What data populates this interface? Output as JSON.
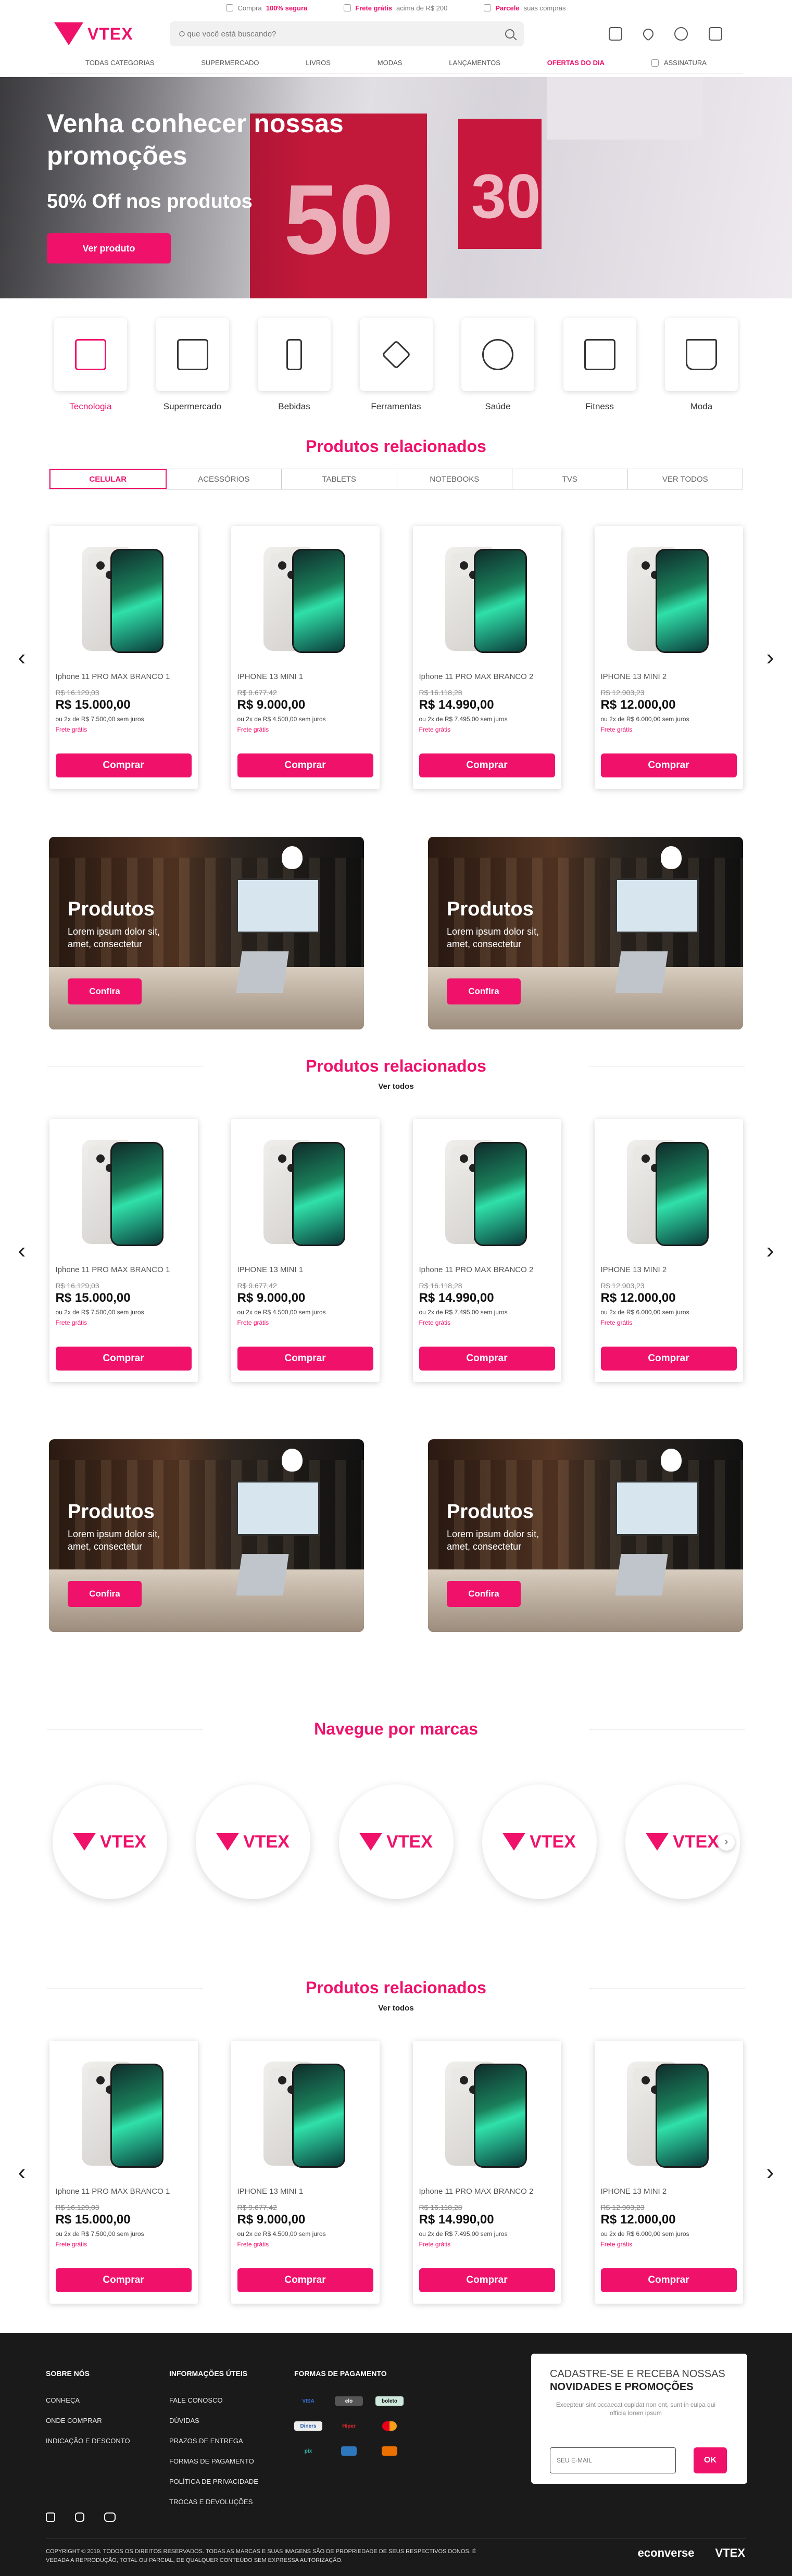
{
  "topbar": {
    "items": [
      {
        "pre": "Compra ",
        "bold": "100% segura",
        "post": ""
      },
      {
        "pre": "",
        "bold": "Frete grátis",
        "post": " acima de R$ 200"
      },
      {
        "pre": "",
        "bold": "Parcele",
        "post": " suas compras"
      }
    ]
  },
  "header": {
    "logo_text": "VTEX",
    "search_placeholder": "O que você está buscando?"
  },
  "nav": {
    "items": [
      "TODAS CATEGORIAS",
      "SUPERMERCADO",
      "LIVROS",
      "MODAS",
      "LANÇAMENTOS",
      "OFERTAS DO DIA",
      "ASSINATURA"
    ]
  },
  "hero": {
    "title": "Venha conhecer nossas promoções",
    "subtitle": "50% Off nos produtos",
    "cta": "Ver produto"
  },
  "categories": [
    {
      "label": "Tecnologia",
      "icon": "monitor-icon"
    },
    {
      "label": "Supermercado",
      "icon": "store-icon"
    },
    {
      "label": "Bebidas",
      "icon": "bottle-icon"
    },
    {
      "label": "Ferramentas",
      "icon": "tools-icon"
    },
    {
      "label": "Saúde",
      "icon": "health-icon"
    },
    {
      "label": "Fitness",
      "icon": "treadmill-icon"
    },
    {
      "label": "Moda",
      "icon": "fashion-icon"
    }
  ],
  "shelf1": {
    "title": "Produtos relacionados",
    "tabs": [
      "CELULAR",
      "ACESSÓRIOS",
      "TABLETS",
      "NOTEBOOKS",
      "TVS",
      "VER TODOS"
    ],
    "products": [
      {
        "name": "Iphone 11 PRO MAX BRANCO 1",
        "old": "R$ 16.129,03",
        "price": "R$ 15.000,00",
        "inst": "ou 2x de R$ 7.500,00 sem juros",
        "ship": "Frete grátis",
        "cta": "Comprar"
      },
      {
        "name": "IPHONE 13 MINI 1",
        "old": "R$ 9.677,42",
        "price": "R$ 9.000,00",
        "inst": "ou 2x de R$ 4.500,00 sem juros",
        "ship": "Frete grátis",
        "cta": "Comprar"
      },
      {
        "name": "Iphone 11 PRO MAX BRANCO 2",
        "old": "R$ 16.118,28",
        "price": "R$ 14.990,00",
        "inst": "ou 2x de R$ 7.495,00 sem juros",
        "ship": "Frete grátis",
        "cta": "Comprar"
      },
      {
        "name": "IPHONE 13 MINI 2",
        "old": "R$ 12.903,23",
        "price": "R$ 12.000,00",
        "inst": "ou 2x de R$ 6.000,00 sem juros",
        "ship": "Frete grátis",
        "cta": "Comprar"
      }
    ]
  },
  "banners": {
    "title": "Produtos",
    "text": "Lorem ipsum dolor sit, amet, consectetur",
    "cta": "Confira"
  },
  "shelf2": {
    "title": "Produtos relacionados",
    "see_all": "Ver todos",
    "products": [
      {
        "name": "Iphone 11 PRO MAX BRANCO 1",
        "old": "R$ 16.129,03",
        "price": "R$ 15.000,00",
        "inst": "ou 2x de R$ 7.500,00 sem juros",
        "ship": "Frete grátis",
        "cta": "Comprar"
      },
      {
        "name": "IPHONE 13 MINI 1",
        "old": "R$ 9.677,42",
        "price": "R$ 9.000,00",
        "inst": "ou 2x de R$ 4.500,00 sem juros",
        "ship": "Frete grátis",
        "cta": "Comprar"
      },
      {
        "name": "Iphone 11 PRO MAX BRANCO 2",
        "old": "R$ 16.118,28",
        "price": "R$ 14.990,00",
        "inst": "ou 2x de R$ 7.495,00 sem juros",
        "ship": "Frete grátis",
        "cta": "Comprar"
      },
      {
        "name": "IPHONE 13 MINI 2",
        "old": "R$ 12.903,23",
        "price": "R$ 12.000,00",
        "inst": "ou 2x de R$ 6.000,00 sem juros",
        "ship": "Frete grátis",
        "cta": "Comprar"
      }
    ]
  },
  "brands": {
    "title": "Navegue por marcas",
    "items": [
      "VTEX",
      "VTEX",
      "VTEX",
      "VTEX",
      "VTEX"
    ]
  },
  "shelf3": {
    "title": "Produtos relacionados",
    "see_all": "Ver todos",
    "products": [
      {
        "name": "Iphone 11 PRO MAX BRANCO 1",
        "old": "R$ 16.129,03",
        "price": "R$ 15.000,00",
        "inst": "ou 2x de R$ 7.500,00 sem juros",
        "ship": "Frete grátis",
        "cta": "Comprar"
      },
      {
        "name": "IPHONE 13 MINI 1",
        "old": "R$ 9.677,42",
        "price": "R$ 9.000,00",
        "inst": "ou 2x de R$ 4.500,00 sem juros",
        "ship": "Frete grátis",
        "cta": "Comprar"
      },
      {
        "name": "Iphone 11 PRO MAX BRANCO 2",
        "old": "R$ 16.118,28",
        "price": "R$ 14.990,00",
        "inst": "ou 2x de R$ 7.495,00 sem juros",
        "ship": "Frete grátis",
        "cta": "Comprar"
      },
      {
        "name": "IPHONE 13 MINI 2",
        "old": "R$ 12.903,23",
        "price": "R$ 12.000,00",
        "inst": "ou 2x de R$ 6.000,00 sem juros",
        "ship": "Frete grátis",
        "cta": "Comprar"
      }
    ]
  },
  "footer": {
    "about": {
      "title": "SOBRE NÓS",
      "links": [
        "CONHEÇA",
        "ONDE COMPRAR",
        "INDICAÇÃO E DESCONTO"
      ]
    },
    "info": {
      "title": "INFORMAÇÕES ÚTEIS",
      "links": [
        "FALE CONOSCO",
        "DÚVIDAS",
        "PRAZOS DE ENTREGA",
        "FORMAS DE PAGAMENTO",
        "POLÍTICA DE PRIVACIDADE",
        "TROCAS E DEVOLUÇÕES"
      ]
    },
    "payments": {
      "title": "FORMAS DE PAGAMENTO",
      "items": [
        "VISA",
        "elo",
        "boleto",
        "Diners",
        "Hiper",
        "Mastercard",
        "pix",
        "Amex",
        "Itaú",
        "Paypal"
      ]
    },
    "newsletter": {
      "line1": "CADASTRE-SE E RECEBA NOSSAS",
      "line2": "NOVIDADES E PROMOÇÕES",
      "text": "Excepteur sint occaecat cupidat non ent, sunt in culpa qui officia lorem ipsum",
      "placeholder": "SEU E-MAIL",
      "cta": "OK"
    },
    "copyright": "COPYRIGHT © 2019. TODOS OS DIREITOS RESERVADOS. TODAS AS MARCAS E SUAS IMAGENS SÃO DE PROPRIEDADE DE SEUS RESPECTIVOS DONOS. É VEDADA A REPRODUÇÃO, TOTAL OU PARCIAL, DE QUALQUER CONTEÚDO SEM EXPRESSA AUTORIZAÇÃO.",
    "logos": [
      "econverse",
      "VTEX"
    ]
  },
  "colors": {
    "accent": "#f0116b",
    "footer_bg": "#1a1a1a"
  }
}
